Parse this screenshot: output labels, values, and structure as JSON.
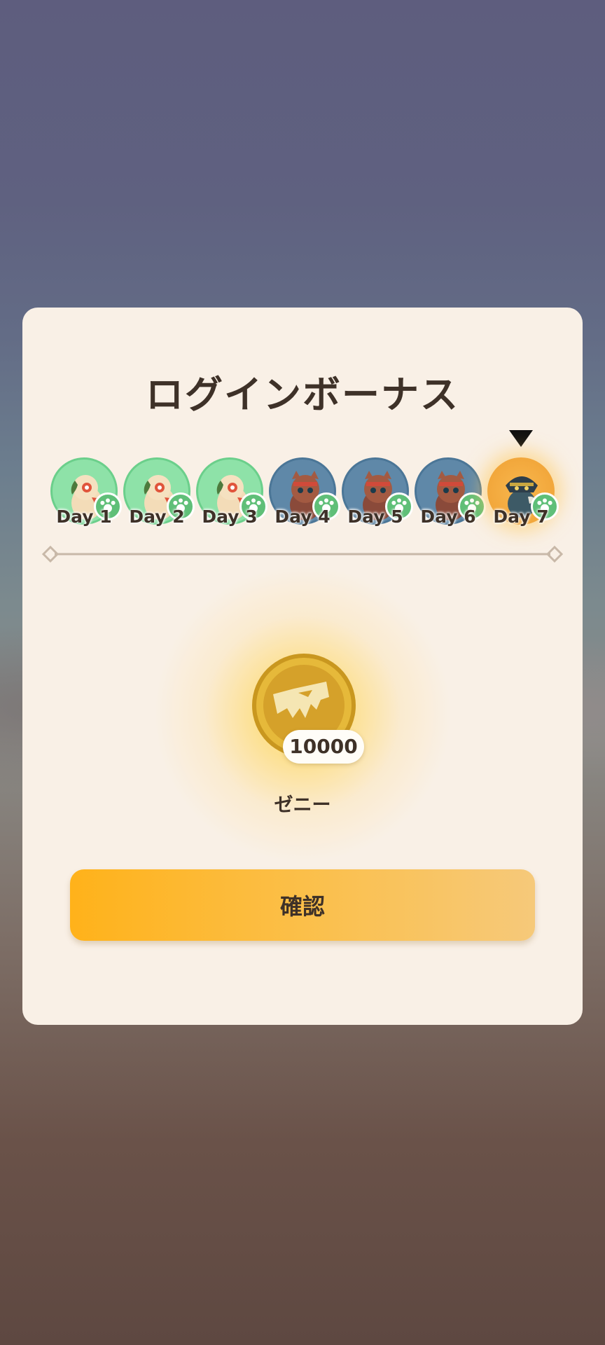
{
  "dialog": {
    "title": "ログインボーナス",
    "days": [
      {
        "label": "Day 1",
        "state": "claimed",
        "icon": "green-bird-creature-icon"
      },
      {
        "label": "Day 2",
        "state": "claimed",
        "icon": "green-bird-creature-icon"
      },
      {
        "label": "Day 3",
        "state": "claimed",
        "icon": "green-bird-creature-icon"
      },
      {
        "label": "Day 4",
        "state": "upcoming",
        "icon": "blue-cat-creature-icon"
      },
      {
        "label": "Day 5",
        "state": "upcoming",
        "icon": "blue-cat-creature-icon"
      },
      {
        "label": "Day 6",
        "state": "upcoming",
        "icon": "blue-cat-creature-icon"
      },
      {
        "label": "Day 7",
        "state": "current",
        "icon": "gold-creature-icon"
      }
    ],
    "reward": {
      "icon": "zenny-coin-icon",
      "amount": "10000",
      "name": "ゼニー"
    },
    "confirm_label": "確認"
  },
  "colors": {
    "panel": "#f9f0e6",
    "text": "#3e3128",
    "button_start": "#ffb21a",
    "button_end": "#f6c97a",
    "claimed_green": "#8ee2a8",
    "upcoming_blue": "#5f88a8",
    "current_gold": "#f2a73b"
  }
}
